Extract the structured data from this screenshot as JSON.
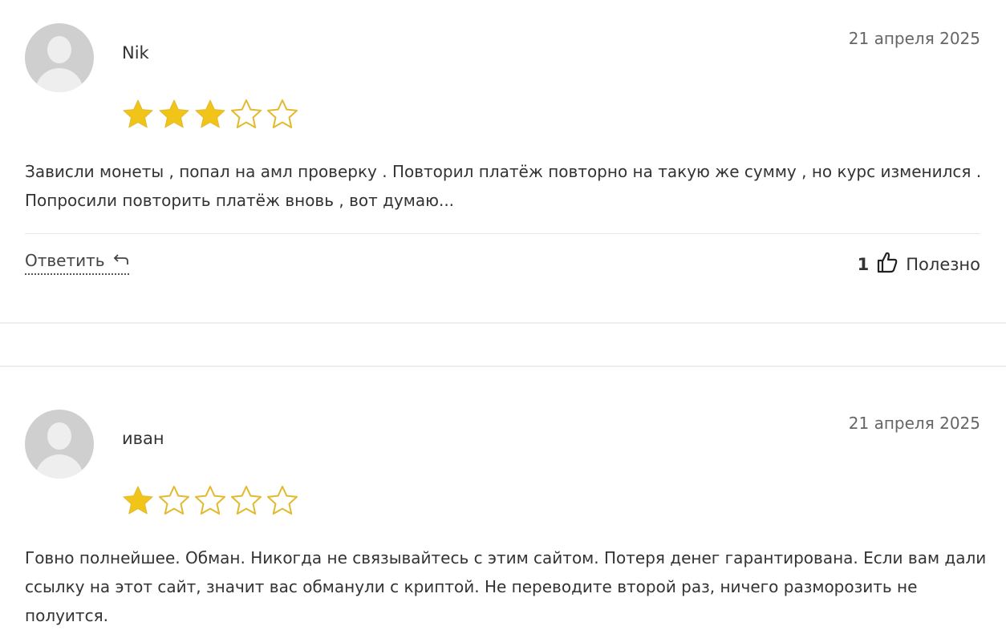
{
  "reviews": [
    {
      "author": "Nik",
      "date": "21 апреля 2025",
      "rating": 3,
      "rating_max": 5,
      "text": "Зависли монеты , попал на амл проверку . Повторил платёж повторно на такую же сумму , но курс изменился . Попросили повторить платёж вновь , вот думаю...",
      "reply_label": "Ответить",
      "helpful_count": "1",
      "helpful_label": "Полезно"
    },
    {
      "author": "иван",
      "date": "21 апреля 2025",
      "rating": 1,
      "rating_max": 5,
      "text": "Говно полнейшее. Обман. Никогда не связывайтесь с этим сайтом. Потеря денег гарантирована. Если вам дали ссылку на этот сайт, значит вас обманули с криптой. Не переводите второй раз, ничего разморозить не полуится."
    }
  ],
  "colors": {
    "star_filled": "#f0c419",
    "star_outline": "#e3b92e",
    "avatar_bg": "#cfcfcf"
  },
  "icons": {
    "reply": "reply-arrow-icon",
    "helpful": "thumbs-up-icon",
    "avatar": "user-placeholder-icon"
  }
}
